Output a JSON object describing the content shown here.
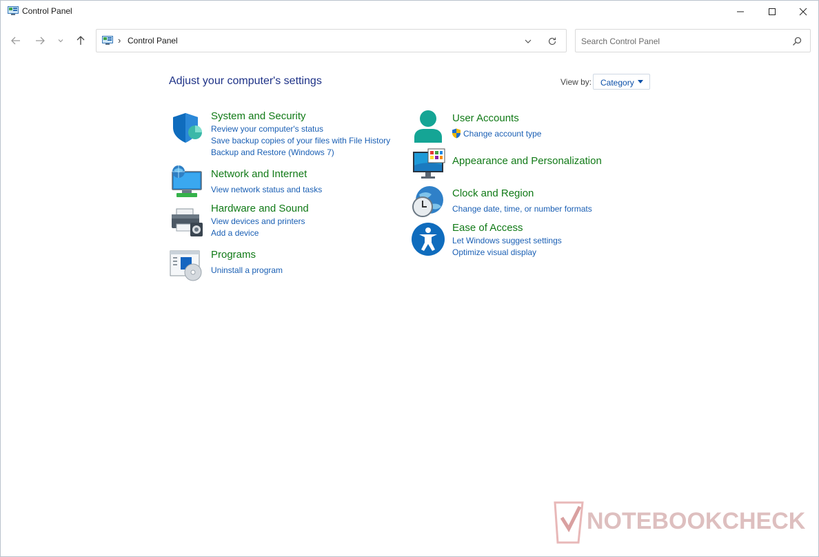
{
  "window": {
    "title": "Control Panel"
  },
  "nav": {
    "breadcrumb_separator": "›",
    "breadcrumb": "Control Panel",
    "search_placeholder": "Search Control Panel"
  },
  "content": {
    "title": "Adjust your computer's settings",
    "view_by_label": "View by:",
    "view_by_value": "Category"
  },
  "categories": {
    "system_security": {
      "title": "System and Security",
      "links": [
        "Review your computer's status",
        "Save backup copies of your files with File History",
        "Backup and Restore (Windows 7)"
      ],
      "icon": "shield-icon"
    },
    "network_internet": {
      "title": "Network and Internet",
      "links": [
        "View network status and tasks"
      ],
      "icon": "network-globe-icon"
    },
    "hardware_sound": {
      "title": "Hardware and Sound",
      "links": [
        "View devices and printers",
        "Add a device"
      ],
      "icon": "printer-speaker-icon"
    },
    "programs": {
      "title": "Programs",
      "links": [
        "Uninstall a program"
      ],
      "icon": "programs-disc-icon"
    },
    "user_accounts": {
      "title": "User Accounts",
      "links": [
        "Change account type"
      ],
      "icon": "user-icon"
    },
    "appearance": {
      "title": "Appearance and Personalization",
      "links": [],
      "icon": "monitor-palette-icon"
    },
    "clock_region": {
      "title": "Clock and Region",
      "links": [
        "Change date, time, or number formats"
      ],
      "icon": "clock-globe-icon"
    },
    "ease_access": {
      "title": "Ease of Access",
      "links": [
        "Let Windows suggest settings",
        "Optimize visual display"
      ],
      "icon": "accessibility-icon"
    }
  },
  "watermark": {
    "text": "NOTEBOOKCHECK"
  },
  "colors": {
    "page_title": "#1e3287",
    "category_title": "#117a17",
    "link": "#1a5fb4"
  }
}
